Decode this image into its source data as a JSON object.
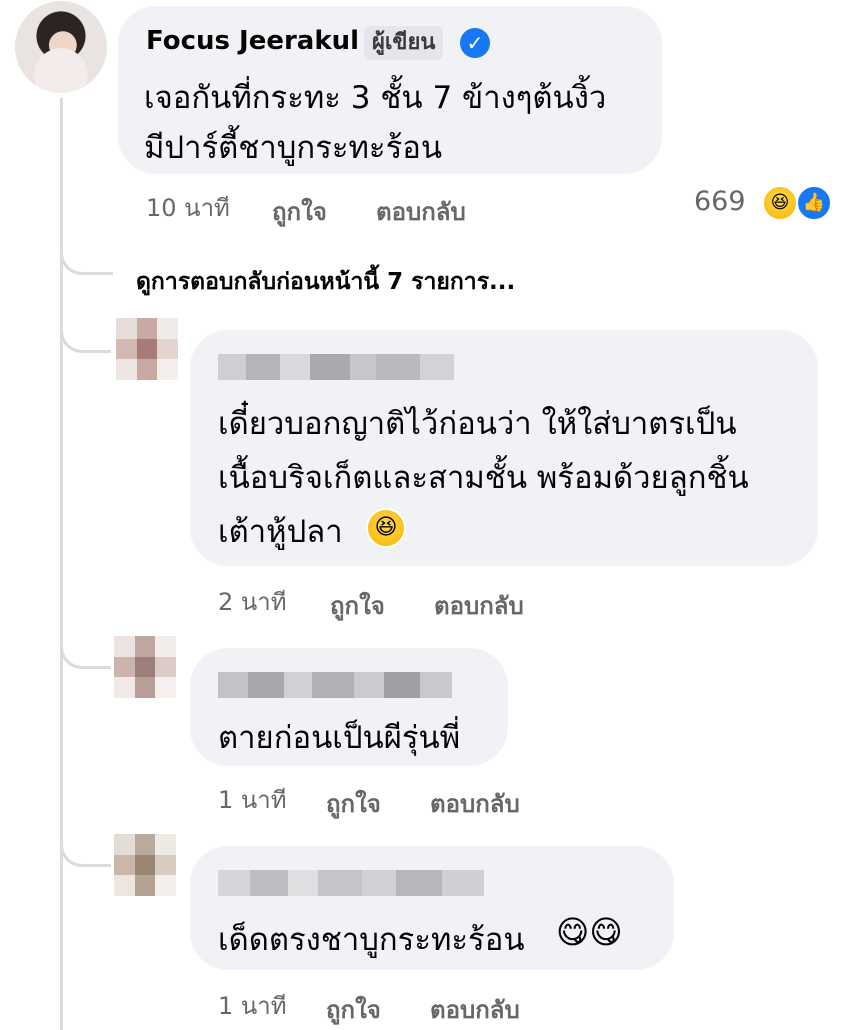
{
  "top_comment": {
    "author_name": "Focus Jeerakul",
    "author_badge": "ผู้เขียน",
    "verified_glyph": "✓",
    "text_lines": [
      "เจอกันที่กระทะ 3 ชั้น 7 ข้างๆต้นงิ้ว",
      "มีปาร์ตี้ชาบูกระทะร้อน"
    ],
    "time": "10 นาที",
    "like_label": "ถูกใจ",
    "reply_label": "ตอบกลับ",
    "reaction_count": "669",
    "reaction_icons": [
      "laugh-emoji",
      "like-emoji"
    ]
  },
  "view_previous_replies": "ดูการตอบกลับก่อนหน้านี้ 7 รายการ...",
  "replies": [
    {
      "text_lines": [
        "เดี๋ยวบอกญาติไว้ก่อนว่า ให้ใส่บาตรเป็น",
        "เนื้อบริจเก็ตและสามชั้น พร้อมด้วยลูกชิ้น",
        "เต้าหู้ปลา"
      ],
      "emoji": "😆",
      "time": "2 นาที",
      "like_label": "ถูกใจ",
      "reply_label": "ตอบกลับ"
    },
    {
      "text_lines": [
        "ตายก่อนเป็นผีรุ่นพี่"
      ],
      "time": "1 นาที",
      "like_label": "ถูกใจ",
      "reply_label": "ตอบกลับ"
    },
    {
      "text_lines": [
        "เด็ดตรงชาบูกระทะร้อน"
      ],
      "emoji": "😋😋",
      "time": "1 นาที",
      "like_label": "ถูกใจ",
      "reply_label": "ตอบกลับ"
    }
  ],
  "colors": {
    "bubble": "#f0f2f5",
    "meta_text": "#65676b",
    "verified_blue": "#1877f2"
  }
}
